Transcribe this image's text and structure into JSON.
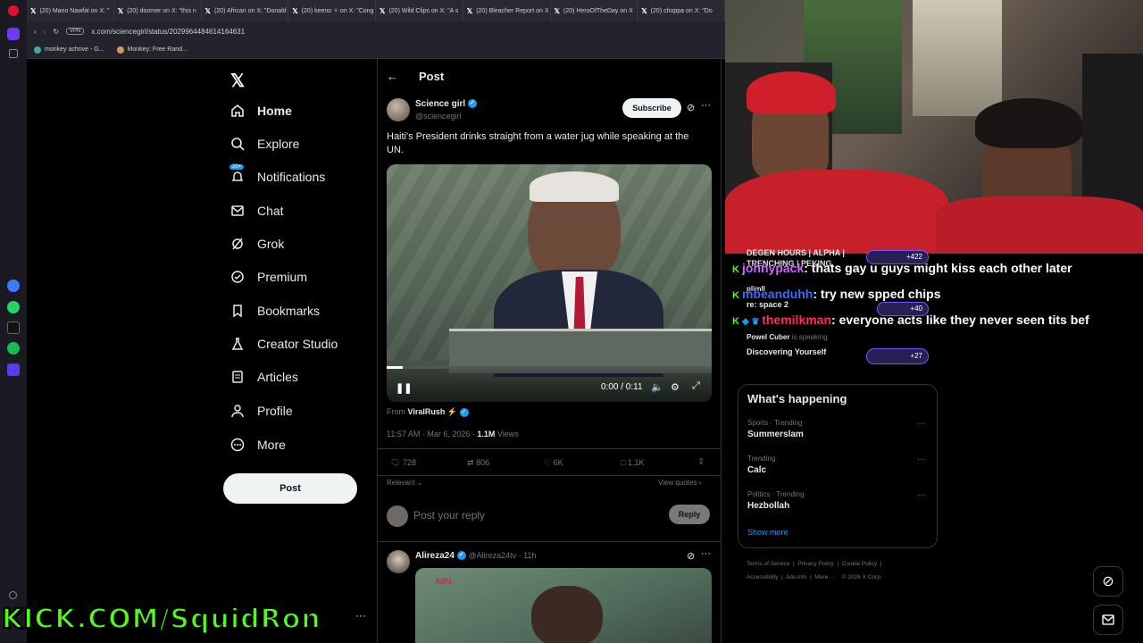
{
  "browser": {
    "tabs": [
      "(20) Mario Nawfal on X: \"",
      "(20) doomer on X: \"this n",
      "(20) African on X: \"Donald",
      "(20) keeno ✧ on X: \"Cong",
      "(20) Wild Clips on X: \"A s",
      "(20) Bleacher Report on X",
      "(20) HeroOfTheDay on X",
      "(20) choppa on X: \"Do"
    ],
    "vpn": "VPN",
    "url": "x.com/sciencegirl/status/2029964484614164631",
    "bookmarks": [
      "monkey achrive - G...",
      "Monkey: Free Rand..."
    ]
  },
  "nav": {
    "items": [
      "Home",
      "Explore",
      "Notifications",
      "Chat",
      "Grok",
      "Premium",
      "Bookmarks",
      "Creator Studio",
      "Articles",
      "Profile",
      "More"
    ],
    "notif_badge": "20+",
    "post_button": "Post"
  },
  "post": {
    "header": "Post",
    "author_name": "Science girl",
    "author_handle": "@sciencegirl",
    "subscribe": "Subscribe",
    "text": "Haiti's President drinks straight from a water jug while speaking at the UN.",
    "video_time": "0:00 / 0:11",
    "from_label": "From",
    "from_name": "ViralRush ⚡",
    "timestamp": "11:57 AM · Mar 6, 2026 ·",
    "views_count": "1.1M",
    "views_label": "Views",
    "replies": "728",
    "reposts": "806",
    "likes": "6K",
    "bookmarks": "1.1K",
    "sort": "Relevant",
    "view_quotes": "View quotes",
    "reply_placeholder": "Post your reply",
    "reply_button": "Reply",
    "video_progress": 0.05
  },
  "reply": {
    "author_name": "Alireza24",
    "author_handle": "@Alireza24tv · 11h",
    "media_tag": "ABN"
  },
  "spaces": {
    "title1": "DEGEN HOURS | ALPHA |",
    "title1b": "TRENCHING | PEKING",
    "count1": "+422",
    "host2": "plimll",
    "count2": "+40",
    "title2": "re: space 2",
    "host3": "Powel Cuber",
    "speaking": "is speaking",
    "title3": "Discovering Yourself",
    "count3": "+27"
  },
  "chat": [
    {
      "user": "johnypack",
      "user_color": "#d066ff",
      "msg": ": thats gay u guys might kiss each other later"
    },
    {
      "user": "mbeanduhh",
      "user_color": "#3a6bff",
      "msg": ": try new spped chips"
    },
    {
      "user": "themilkman",
      "user_color": "#ff2d55",
      "msg": ": everyone acts like they never seen tits bef"
    }
  ],
  "trends": {
    "title": "What's happening",
    "items": [
      {
        "context": "Sports · Trending",
        "name": "Summerslam"
      },
      {
        "context": "Trending",
        "name": "Calc"
      },
      {
        "context": "Politics · Trending",
        "name": "Hezbollah"
      }
    ],
    "show_more": "Show more"
  },
  "footer": {
    "line1": [
      "Terms of Service",
      "Privacy Policy",
      "Cookie Policy"
    ],
    "line2": [
      "Accessibility",
      "Ads info",
      "More ···",
      "© 2026 X Corp."
    ]
  },
  "overlay": {
    "kick": "KICK.COM/SquidRon"
  },
  "colors": {
    "accent": "#1d9bf0",
    "kick_green": "#53fc18"
  }
}
